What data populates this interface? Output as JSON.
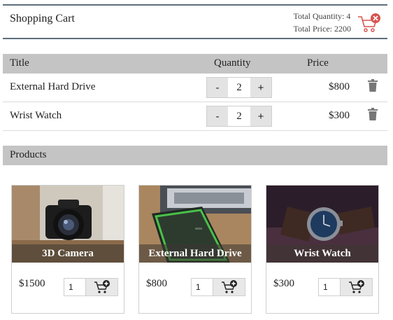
{
  "header": {
    "title": "Shopping Cart",
    "total_quantity": "Total Quantity: 4",
    "total_price": "Total Price: 2200"
  },
  "table": {
    "col_title": "Title",
    "col_quantity": "Quantity",
    "col_price": "Price",
    "rows": [
      {
        "title": "External Hard Drive",
        "quantity": "2",
        "price": "$800",
        "minus": "-",
        "plus": "+"
      },
      {
        "title": "Wrist Watch",
        "quantity": "2",
        "price": "$300",
        "minus": "-",
        "plus": "+"
      }
    ]
  },
  "products": {
    "heading": "Products",
    "items": [
      {
        "name": "3D Camera",
        "price": "$1500",
        "qty": "1"
      },
      {
        "name": "External Hard Drive",
        "price": "$800",
        "qty": "1"
      },
      {
        "name": "Wrist Watch",
        "price": "$300",
        "qty": "1"
      }
    ]
  },
  "colors": {
    "accent_red": "#d9534f",
    "header_border": "#5b6f7d",
    "bar_gray": "#c4c4c4"
  },
  "icons": {
    "cart_remove": "cart-remove-icon",
    "trash": "trash-icon",
    "cart_add": "cart-add-icon"
  }
}
